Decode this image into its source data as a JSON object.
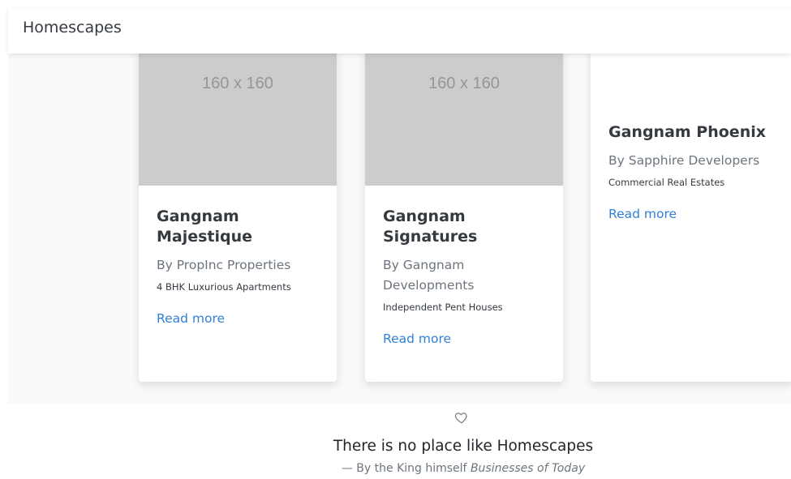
{
  "navbar": {
    "brand": "Homescapes"
  },
  "cards": [
    {
      "image_placeholder": "160 x 160",
      "title": "Gangnam Majestique",
      "developer": "By PropInc Properties",
      "note": "4 BHK Luxurious Apartments",
      "link": "Read more"
    },
    {
      "image_placeholder": "160 x 160",
      "title": "Gangnam Signatures",
      "developer": "By Gangnam Developments",
      "note": "Independent Pent Houses",
      "link": "Read more"
    },
    {
      "title": "Gangnam Phoenix",
      "developer": "By Sapphire Developers",
      "note": "Commercial Real Estates",
      "link": "Read more"
    }
  ],
  "footer": {
    "icon": "heart-outline-icon",
    "quote": "There is no place like Homescapes",
    "attribution_prefix": "— By the King himself",
    "attribution_source": "Businesses of Today"
  },
  "colors": {
    "link": "#2f80d8",
    "placeholder_bg": "#cccccc",
    "section_bg": "#f8f9fa"
  }
}
